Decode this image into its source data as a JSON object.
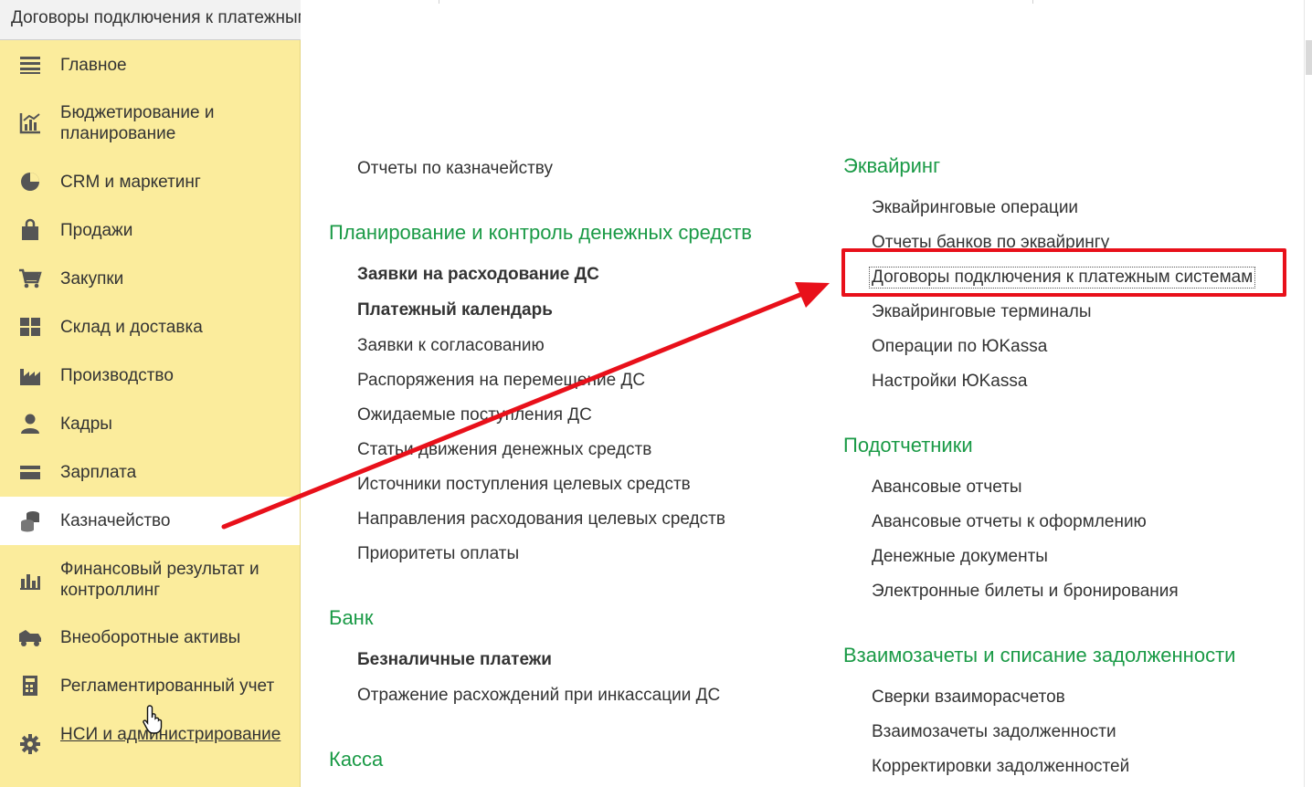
{
  "window": {
    "title": "Договоры подключения к платежным системам"
  },
  "sidebar": {
    "items": [
      {
        "label": "Главное",
        "icon": "menu-lines-icon"
      },
      {
        "label": "Бюджетирование и планирование",
        "icon": "budget-chart-icon"
      },
      {
        "label": "CRM и маркетинг",
        "icon": "pie-chart-icon"
      },
      {
        "label": "Продажи",
        "icon": "shopping-bag-icon"
      },
      {
        "label": "Закупки",
        "icon": "cart-icon"
      },
      {
        "label": "Склад и доставка",
        "icon": "warehouse-grid-icon"
      },
      {
        "label": "Производство",
        "icon": "factory-icon"
      },
      {
        "label": "Кадры",
        "icon": "person-icon"
      },
      {
        "label": "Зарплата",
        "icon": "wallet-card-icon"
      },
      {
        "label": "Казначейство",
        "icon": "coins-stack-icon",
        "active": true
      },
      {
        "label": "Финансовый результат и контроллинг",
        "icon": "bar-chart-icon"
      },
      {
        "label": "Внеоборотные активы",
        "icon": "truck-icon"
      },
      {
        "label": "Регламентированный учет",
        "icon": "calculator-icon"
      },
      {
        "label": "НСИ и администрирование",
        "icon": "gear-icon",
        "link": true
      }
    ]
  },
  "left_column": {
    "top_link": "Отчеты по казначейству",
    "planning": {
      "title": "Планирование и контроль денежных средств",
      "items": [
        {
          "label": "Заявки на расходование ДС",
          "bold": true
        },
        {
          "label": "Платежный календарь",
          "bold": true
        },
        {
          "label": "Заявки к согласованию"
        },
        {
          "label": "Распоряжения на перемещение ДС"
        },
        {
          "label": "Ожидаемые поступления ДС"
        },
        {
          "label": "Статьи движения денежных средств"
        },
        {
          "label": "Источники поступления целевых средств"
        },
        {
          "label": "Направления расходования целевых средств"
        },
        {
          "label": "Приоритеты оплаты"
        }
      ]
    },
    "bank": {
      "title": "Банк",
      "items": [
        {
          "label": "Безналичные платежи",
          "bold": true
        },
        {
          "label": "Отражение расхождений при инкассации ДС"
        }
      ]
    },
    "cash": {
      "title": "Касса"
    }
  },
  "right_column": {
    "acquiring": {
      "title": "Эквайринг",
      "items": [
        {
          "label": "Эквайринговые операции"
        },
        {
          "label": "Отчеты банков по эквайрингу"
        },
        {
          "label": "Договоры подключения к платежным системам",
          "focused": true
        },
        {
          "label": "Эквайринговые терминалы"
        },
        {
          "label": "Операции по ЮKassa"
        },
        {
          "label": "Настройки ЮKassa"
        }
      ]
    },
    "accountables": {
      "title": "Подотчетники",
      "items": [
        {
          "label": "Авансовые отчеты"
        },
        {
          "label": "Авансовые отчеты к оформлению"
        },
        {
          "label": "Денежные документы"
        },
        {
          "label": "Электронные билеты и бронирования"
        }
      ]
    },
    "offsets": {
      "title": "Взаимозачеты и списание задолженности",
      "items": [
        {
          "label": "Сверки взаиморасчетов"
        },
        {
          "label": "Взаимозачеты задолженности"
        },
        {
          "label": "Корректировки задолженностей"
        }
      ]
    }
  },
  "colors": {
    "sidebar_bg": "#fbec9c",
    "section_green": "#1a9a46",
    "annotation_red": "#e8101a"
  }
}
